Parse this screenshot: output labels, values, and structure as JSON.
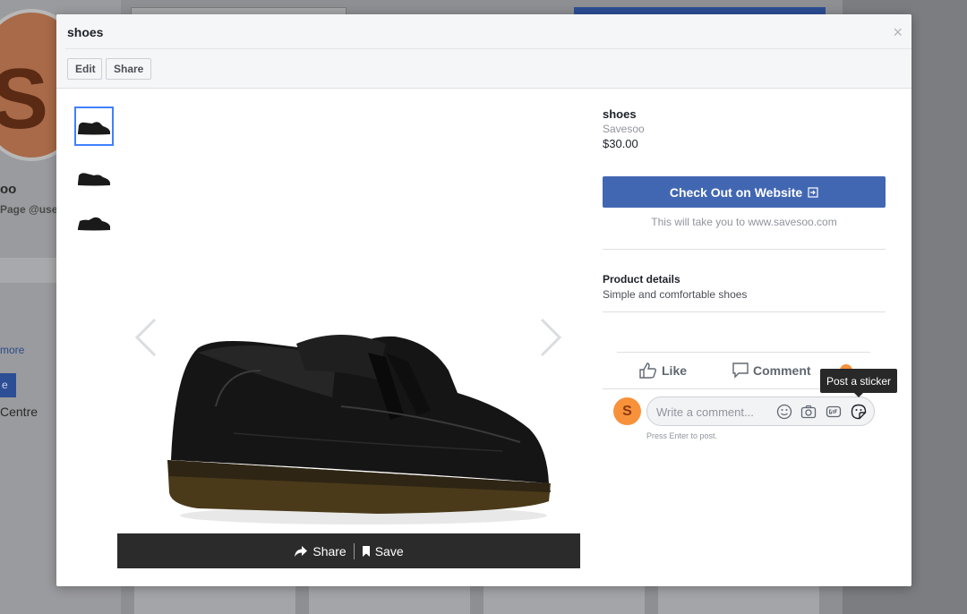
{
  "background": {
    "avatar_letter": "S",
    "page_name": "oo",
    "page_handle": "Page @use",
    "more_link": "more",
    "blue_button": "e",
    "centre_text": "Centre"
  },
  "modal": {
    "title": "shoes",
    "close_glyph": "×",
    "edit_label": "Edit",
    "share_label": "Share"
  },
  "photo_bar": {
    "share_label": "Share",
    "save_label": "Save"
  },
  "product": {
    "title": "shoes",
    "seller": "Savesoo",
    "price": "$30.00",
    "checkout_label": "Check Out on Website",
    "checkout_note": "This will take you to www.savesoo.com",
    "details_heading": "Product details",
    "details_text": "Simple and comfortable shoes"
  },
  "actions": {
    "like_label": "Like",
    "comment_label": "Comment"
  },
  "comment": {
    "avatar_letter": "S",
    "placeholder": "Write a comment...",
    "hint": "Press Enter to post.",
    "tooltip": "Post a sticker"
  },
  "colors": {
    "accent": "#4267b2",
    "avatar": "#f7923b",
    "photo_bar": "#2b2b2b"
  }
}
